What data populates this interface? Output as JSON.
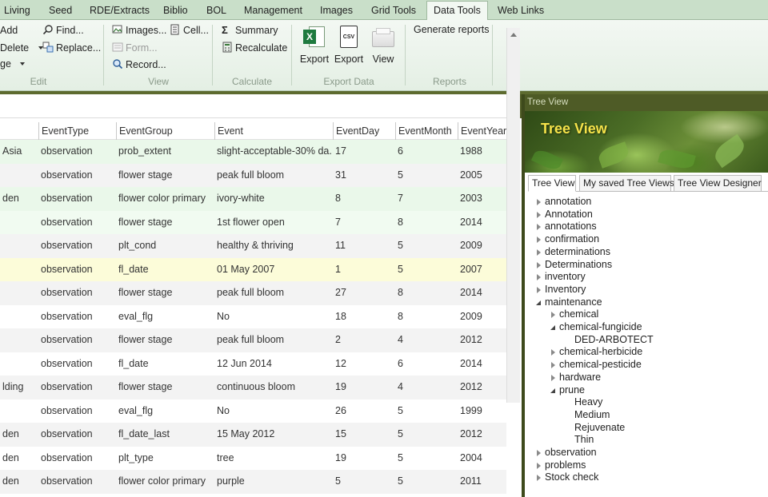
{
  "menu": {
    "tabs": [
      {
        "label": "Living",
        "active": false
      },
      {
        "label": "Seed",
        "active": false
      },
      {
        "label": "RDE/Extracts",
        "active": false
      },
      {
        "label": "Biblio",
        "active": false
      },
      {
        "label": "BOL",
        "active": false
      },
      {
        "label": "Management",
        "active": false
      },
      {
        "label": "Images",
        "active": false
      },
      {
        "label": "Grid Tools",
        "active": false
      },
      {
        "label": "Data Tools",
        "active": true
      },
      {
        "label": "Web Links",
        "active": false
      }
    ]
  },
  "ribbon": {
    "edit": {
      "add": "Add",
      "delete": "Delete",
      "ge": "ge",
      "find": "Find...",
      "replace": "Replace...",
      "label": "Edit"
    },
    "view": {
      "images": "Images...",
      "cell": "Cell...",
      "form": "Form...",
      "record": "Record...",
      "label": "View"
    },
    "calculate": {
      "summary": "Summary",
      "recalculate": "Recalculate",
      "label": "Calculate"
    },
    "export_data": {
      "export_excel": "Export",
      "export_csv": "Export",
      "view": "View",
      "label": "Export Data",
      "csv_text": "CSV"
    },
    "reports": {
      "generate": "Generate reports",
      "label": "Reports"
    }
  },
  "grid": {
    "columns": [
      "EventType",
      "EventGroup",
      "Event",
      "EventDay",
      "EventMonth",
      "EventYear"
    ],
    "rows": [
      {
        "prefix": "Asia",
        "type": "observation",
        "group": "prob_extent",
        "event": "slight-acceptable-30% da...",
        "day": "17",
        "month": "6",
        "year": "1988",
        "bg": "#eaf8ea"
      },
      {
        "prefix": "",
        "type": "observation",
        "group": "flower stage",
        "event": "peak full bloom",
        "day": "31",
        "month": "5",
        "year": "2005",
        "bg": "#f3f3f3"
      },
      {
        "prefix": "den",
        "type": "observation",
        "group": "flower color primary",
        "event": "ivory-white",
        "day": "8",
        "month": "7",
        "year": "2003",
        "bg": "#eaf8ea"
      },
      {
        "prefix": "",
        "type": "observation",
        "group": "flower stage",
        "event": "1st flower open",
        "day": "7",
        "month": "8",
        "year": "2014",
        "bg": "#f1fbf1"
      },
      {
        "prefix": "",
        "type": "observation",
        "group": "plt_cond",
        "event": "healthy & thriving",
        "day": "11",
        "month": "5",
        "year": "2009",
        "bg": "#f3f3f3"
      },
      {
        "prefix": "",
        "type": "observation",
        "group": "fl_date",
        "event": "01 May 2007",
        "day": "1",
        "month": "5",
        "year": "2007",
        "bg": "#fcfcd9"
      },
      {
        "prefix": "",
        "type": "observation",
        "group": "flower stage",
        "event": "peak full bloom",
        "day": "27",
        "month": "8",
        "year": "2014",
        "bg": "#f3f3f3"
      },
      {
        "prefix": "",
        "type": "observation",
        "group": "eval_flg",
        "event": "No",
        "day": "18",
        "month": "8",
        "year": "2009",
        "bg": "#ffffff"
      },
      {
        "prefix": "",
        "type": "observation",
        "group": "flower stage",
        "event": "peak full bloom",
        "day": "2",
        "month": "4",
        "year": "2012",
        "bg": "#f3f3f3"
      },
      {
        "prefix": "",
        "type": "observation",
        "group": "fl_date",
        "event": "12 Jun 2014",
        "day": "12",
        "month": "6",
        "year": "2014",
        "bg": "#ffffff"
      },
      {
        "prefix": "lding",
        "type": "observation",
        "group": "flower stage",
        "event": "continuous bloom",
        "day": "19",
        "month": "4",
        "year": "2012",
        "bg": "#f3f3f3"
      },
      {
        "prefix": "",
        "type": "observation",
        "group": "eval_flg",
        "event": "No",
        "day": "26",
        "month": "5",
        "year": "1999",
        "bg": "#ffffff"
      },
      {
        "prefix": "den",
        "type": "observation",
        "group": "fl_date_last",
        "event": "15 May 2012",
        "day": "15",
        "month": "5",
        "year": "2012",
        "bg": "#f3f3f3"
      },
      {
        "prefix": "den",
        "type": "observation",
        "group": "plt_type",
        "event": "tree",
        "day": "19",
        "month": "5",
        "year": "2004",
        "bg": "#ffffff"
      },
      {
        "prefix": "den",
        "type": "observation",
        "group": "flower color primary",
        "event": "purple",
        "day": "5",
        "month": "5",
        "year": "2011",
        "bg": "#f3f3f3"
      }
    ]
  },
  "tree_view": {
    "panel_title": "Tree View",
    "banner_title": "Tree View",
    "tabs": [
      {
        "label": "Tree View",
        "active": true
      },
      {
        "label": "My saved Tree Views",
        "active": false
      },
      {
        "label": "Tree View Designer",
        "active": false
      }
    ],
    "nodes": [
      {
        "label": "annotation",
        "level": 0,
        "toggle": "closed"
      },
      {
        "label": "Annotation",
        "level": 0,
        "toggle": "closed"
      },
      {
        "label": "annotations",
        "level": 0,
        "toggle": "closed"
      },
      {
        "label": "confirmation",
        "level": 0,
        "toggle": "closed"
      },
      {
        "label": "determinations",
        "level": 0,
        "toggle": "closed"
      },
      {
        "label": "Determinations",
        "level": 0,
        "toggle": "closed"
      },
      {
        "label": "inventory",
        "level": 0,
        "toggle": "closed"
      },
      {
        "label": "Inventory",
        "level": 0,
        "toggle": "closed"
      },
      {
        "label": "maintenance",
        "level": 0,
        "toggle": "open"
      },
      {
        "label": "chemical",
        "level": 1,
        "toggle": "closed"
      },
      {
        "label": "chemical-fungicide",
        "level": 1,
        "toggle": "open"
      },
      {
        "label": "DED-ARBOTECT",
        "level": 2,
        "toggle": "none"
      },
      {
        "label": "chemical-herbicide",
        "level": 1,
        "toggle": "closed"
      },
      {
        "label": "chemical-pesticide",
        "level": 1,
        "toggle": "closed"
      },
      {
        "label": "hardware",
        "level": 1,
        "toggle": "closed"
      },
      {
        "label": "prune",
        "level": 1,
        "toggle": "open"
      },
      {
        "label": "Heavy",
        "level": 2,
        "toggle": "none"
      },
      {
        "label": "Medium",
        "level": 2,
        "toggle": "none"
      },
      {
        "label": "Rejuvenate",
        "level": 2,
        "toggle": "none"
      },
      {
        "label": "Thin",
        "level": 2,
        "toggle": "none"
      },
      {
        "label": "observation",
        "level": 0,
        "toggle": "closed"
      },
      {
        "label": "problems",
        "level": 0,
        "toggle": "closed"
      },
      {
        "label": "Stock check",
        "level": 0,
        "toggle": "closed"
      }
    ]
  },
  "colors": {
    "menubar": "#c9dfc9",
    "ribbon": "#eaf3ea",
    "dark_olive": "#4e5b26",
    "banner_title": "#f6e34a"
  }
}
